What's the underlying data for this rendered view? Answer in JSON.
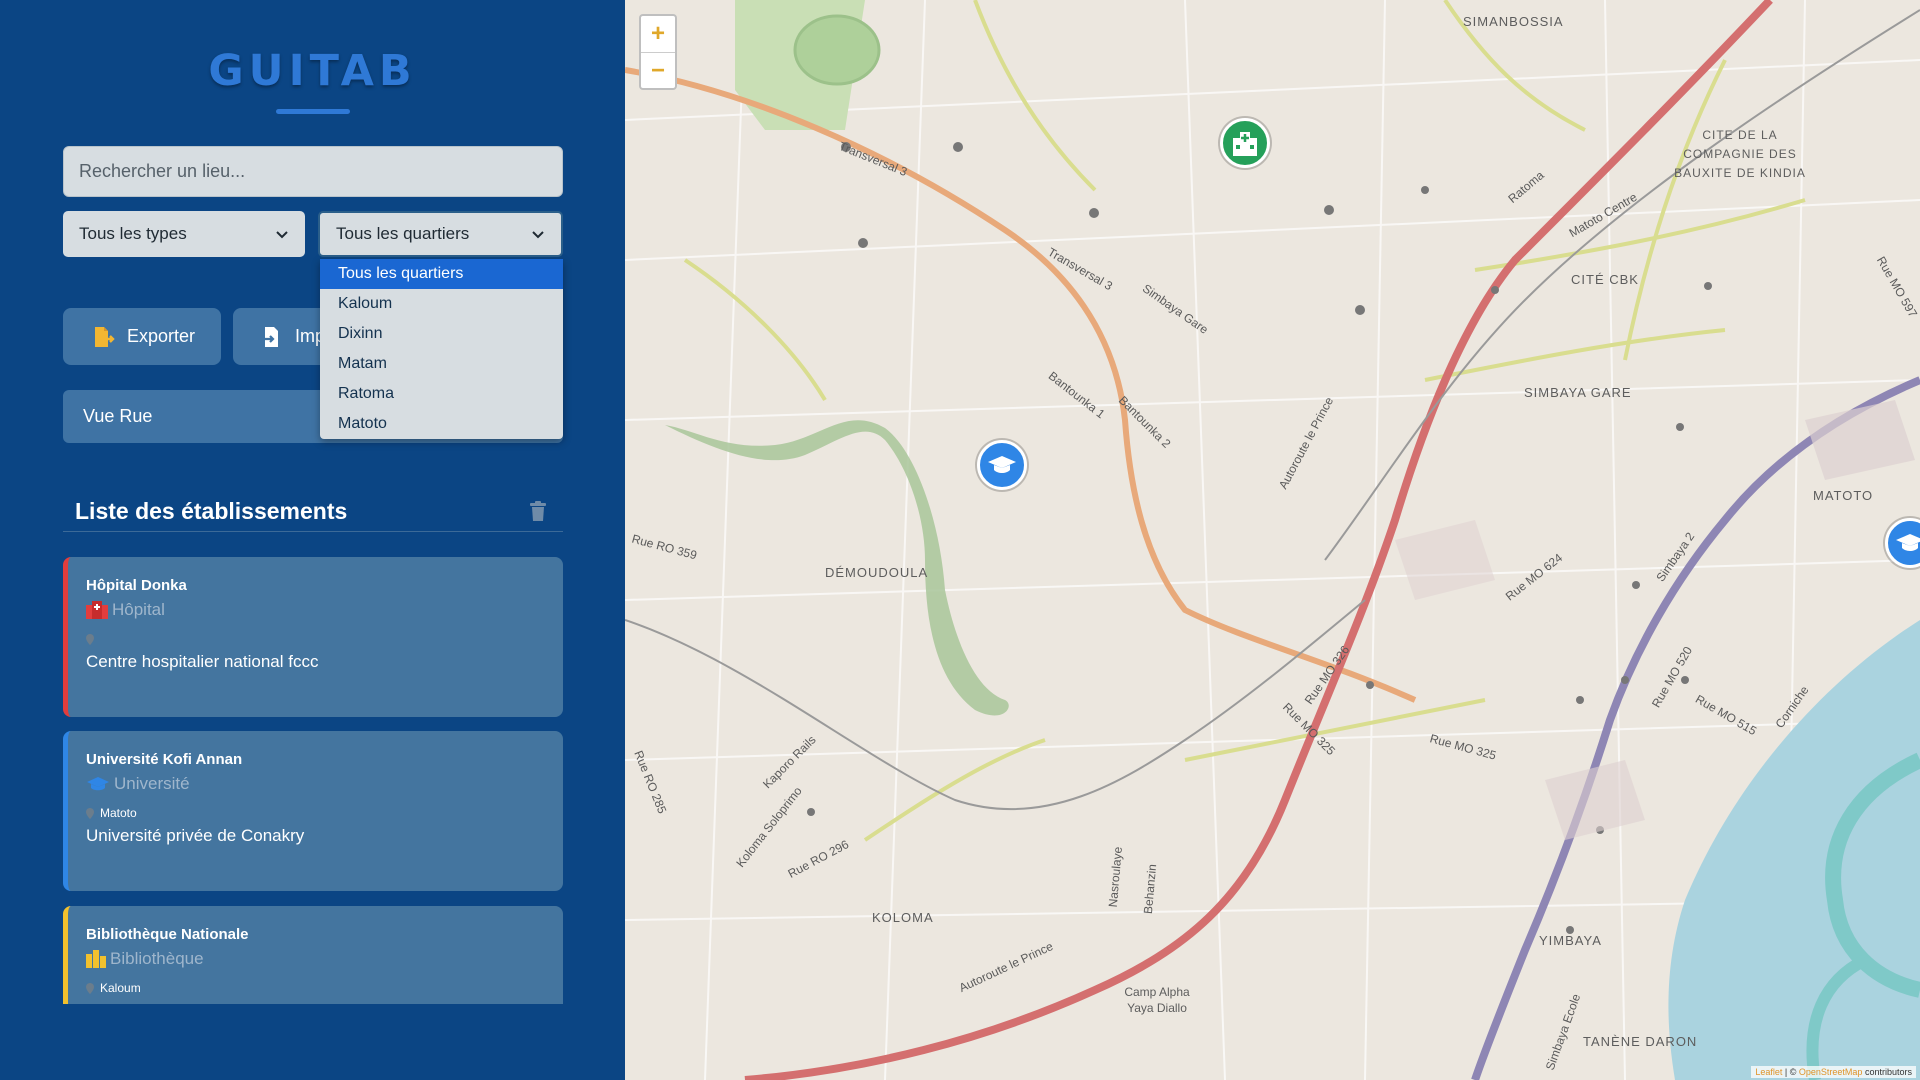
{
  "app": {
    "title": "GUITAB"
  },
  "search": {
    "placeholder": "Rechercher un lieu..."
  },
  "filters": {
    "types_selected": "Tous les types",
    "quartiers_selected": "Tous les quartiers",
    "quartiers_options": [
      "Tous les quartiers",
      "Kaloum",
      "Dixinn",
      "Matam",
      "Ratoma",
      "Matoto"
    ]
  },
  "actions": {
    "export_label": "Exporter",
    "import_label": "Imp"
  },
  "view": {
    "label": "Vue Rue"
  },
  "list": {
    "title": "Liste des établissements",
    "items": [
      {
        "name": "Hôpital Donka",
        "type": "Hôpital",
        "location": "",
        "description": "Centre hospitalier national fccc",
        "color": "#e23d3d",
        "icon": "hospital-icon"
      },
      {
        "name": "Université Kofi Annan",
        "type": "Université",
        "location": "Matoto",
        "description": "Université privée de Conakry",
        "color": "#2f86e6",
        "icon": "graduation-cap-icon"
      },
      {
        "name": "Bibliothèque Nationale",
        "type": "Bibliothèque",
        "location": "Kaloum",
        "description": "",
        "color": "#f2c12e",
        "icon": "books-icon"
      }
    ]
  },
  "map": {
    "zoom_in": "+",
    "zoom_out": "−",
    "places": [
      "SIMANBOSSIA",
      "CITE DE LA COMPAGNIE DES BAUXITE DE KINDIA",
      "CITÉ CBK",
      "SIMBAYA GARE",
      "MATOTO",
      "DÉMOUDOULA",
      "KOLOMA",
      "YIMBAYA",
      "TANÈNE DARON",
      "Camp Alpha Yaya Diallo"
    ],
    "roads": [
      "Transversal 3",
      "Transversal 3",
      "Simbaya Gare",
      "Bantounka 1",
      "Bantounka 2",
      "Autoroute le Prince",
      "Ratoma",
      "Matoto Centre",
      "Rue MO 624",
      "Rue MO 326",
      "Rue MO 325",
      "Rue MO 325",
      "Rue MO 520",
      "Rue MO 515",
      "Rue RO 359",
      "Rue RO 285",
      "Rue RO 296",
      "Koloma Soloprimo",
      "Kaporo Rails",
      "Autoroute le Prince",
      "Nasroulaye",
      "Behanzin",
      "Corniche",
      "Simbaya 2",
      "Rue MO 597",
      "Simbaya Ecole"
    ],
    "attribution": {
      "leaflet": "Leaflet",
      "osm": "OpenStreetMap",
      "suffix": "contributors",
      "sep": " | © "
    },
    "markers": [
      {
        "kind": "university",
        "color": "#2f86e6",
        "icon": "graduation-cap-icon"
      },
      {
        "kind": "hospital",
        "color": "#25a05a",
        "icon": "hospital-building-icon"
      },
      {
        "kind": "university",
        "color": "#2f86e6",
        "icon": "graduation-cap-icon"
      }
    ]
  }
}
